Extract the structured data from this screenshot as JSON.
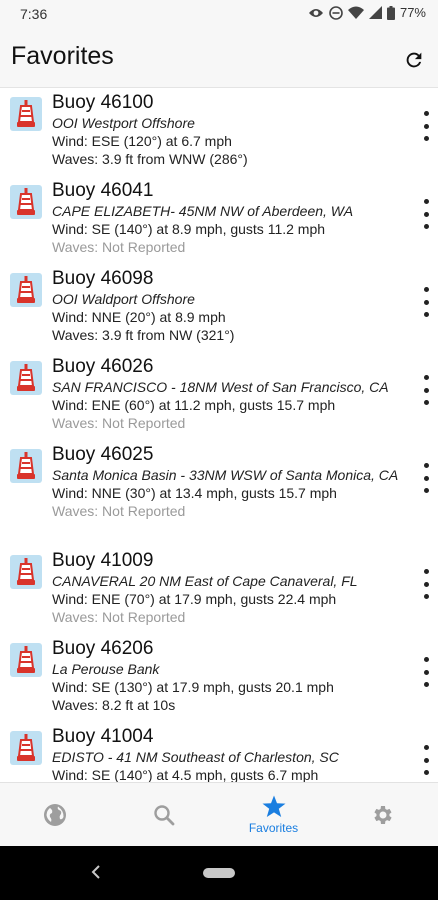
{
  "status_bar": {
    "time": "7:36",
    "battery": "77%"
  },
  "app_bar": {
    "title": "Favorites"
  },
  "buoys": [
    {
      "title": "Buoy 46100",
      "location": "OOI Westport Offshore",
      "wind": "Wind: ESE (120°) at 6.7 mph",
      "waves": "Waves: 3.9 ft from WNW (286°)",
      "waves_reported": true
    },
    {
      "title": "Buoy 46041",
      "location": "CAPE ELIZABETH- 45NM NW of Aberdeen, WA",
      "wind": "Wind: SE (140°) at 8.9 mph, gusts 11.2 mph",
      "waves": "Waves: Not Reported",
      "waves_reported": false
    },
    {
      "title": "Buoy 46098",
      "location": "OOI Waldport Offshore",
      "wind": "Wind: NNE (20°) at 8.9 mph",
      "waves": "Waves: 3.9 ft from NW (321°)",
      "waves_reported": true
    },
    {
      "title": "Buoy 46026",
      "location": "SAN FRANCISCO - 18NM West of San Francisco, CA",
      "wind": "Wind: ENE (60°) at 11.2 mph, gusts 15.7 mph",
      "waves": "Waves: Not Reported",
      "waves_reported": false
    },
    {
      "title": "Buoy 46025",
      "location": "Santa Monica Basin - 33NM WSW of Santa Monica, CA",
      "wind": "Wind: NNE (30°) at 13.4 mph, gusts 15.7 mph",
      "waves": "Waves: Not Reported",
      "waves_reported": false
    },
    {
      "title": "Buoy 41009",
      "location": "CANAVERAL 20 NM East of Cape Canaveral, FL",
      "wind": "Wind: ENE (70°) at 17.9 mph, gusts 22.4 mph",
      "waves": "Waves: Not Reported",
      "waves_reported": false
    },
    {
      "title": "Buoy 46206",
      "location": "La Perouse Bank",
      "wind": "Wind: SE (130°) at 17.9 mph, gusts 20.1 mph",
      "waves": "Waves: 8.2 ft at 10s",
      "waves_reported": true
    },
    {
      "title": "Buoy 41004",
      "location": "EDISTO - 41 NM Southeast of Charleston, SC",
      "wind": "Wind: SE (140°) at 4.5 mph, gusts 6.7 mph",
      "waves": "",
      "waves_reported": true
    }
  ],
  "bottom_nav": {
    "items": [
      {
        "icon": "globe-icon",
        "label": "",
        "active": false
      },
      {
        "icon": "search-icon",
        "label": "",
        "active": false
      },
      {
        "icon": "star-icon",
        "label": "Favorites",
        "active": true
      },
      {
        "icon": "gear-icon",
        "label": "",
        "active": false
      }
    ]
  },
  "colors": {
    "accent": "#1a7ee0",
    "buoy_icon_bg": "#bfe0f2",
    "buoy_red": "#d9342b",
    "muted_text": "#9a9a9a"
  }
}
